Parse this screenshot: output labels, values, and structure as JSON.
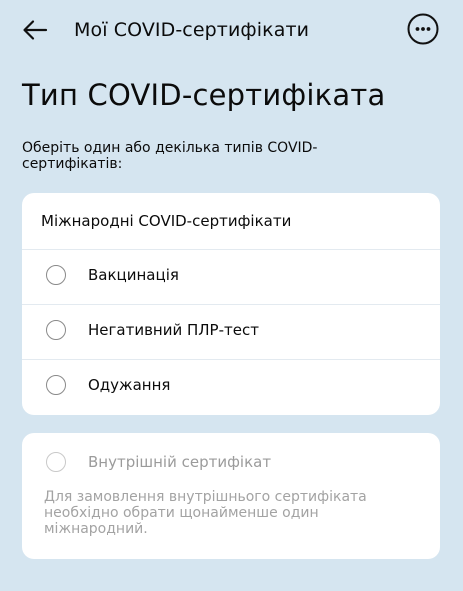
{
  "header": {
    "title": "Мої COVID-сертифікати",
    "back_icon": "arrow-left",
    "menu_icon": "ellipsis-circle"
  },
  "page": {
    "title": "Тип COVID-сертифіката",
    "instruction": "Оберіть один або декілька типів COVID-сертифікатів:"
  },
  "international": {
    "heading": "Міжнародні COVID-сертифікати",
    "options": [
      {
        "label": "Вакцинація",
        "selected": false
      },
      {
        "label": "Негативний ПЛР-тест",
        "selected": false
      },
      {
        "label": "Одужання",
        "selected": false
      }
    ]
  },
  "domestic": {
    "label": "Внутрішній сертифікат",
    "selected": false,
    "enabled": false,
    "note": "Для замовлення внутрішнього сертифіката необхідно обрати щонайменше один міжнародний."
  },
  "colors": {
    "background": "#d5e5f0",
    "card": "#ffffff",
    "text": "#0b0b0b",
    "disabled_text": "#9b9b9b"
  }
}
